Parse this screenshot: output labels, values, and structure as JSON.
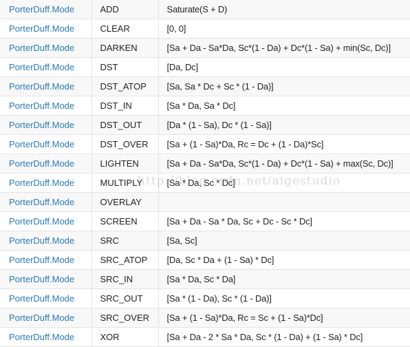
{
  "table": {
    "rows": [
      {
        "class": "PorterDuff.Mode",
        "mode": "ADD",
        "formula": "Saturate(S + D)"
      },
      {
        "class": "PorterDuff.Mode",
        "mode": "CLEAR",
        "formula": "[0, 0]"
      },
      {
        "class": "PorterDuff.Mode",
        "mode": "DARKEN",
        "formula": "[Sa + Da - Sa*Da, Sc*(1 - Da) + Dc*(1 - Sa) + min(Sc, Dc)]"
      },
      {
        "class": "PorterDuff.Mode",
        "mode": "DST",
        "formula": "[Da, Dc]"
      },
      {
        "class": "PorterDuff.Mode",
        "mode": "DST_ATOP",
        "formula": "[Sa, Sa * Dc + Sc * (1 - Da)]"
      },
      {
        "class": "PorterDuff.Mode",
        "mode": "DST_IN",
        "formula": "[Sa * Da, Sa * Dc]"
      },
      {
        "class": "PorterDuff.Mode",
        "mode": "DST_OUT",
        "formula": "[Da * (1 - Sa), Dc * (1 - Sa)]"
      },
      {
        "class": "PorterDuff.Mode",
        "mode": "DST_OVER",
        "formula": "[Sa + (1 - Sa)*Da, Rc = Dc + (1 - Da)*Sc]"
      },
      {
        "class": "PorterDuff.Mode",
        "mode": "LIGHTEN",
        "formula": "[Sa + Da - Sa*Da, Sc*(1 - Da) + Dc*(1 - Sa) + max(Sc, Dc)]"
      },
      {
        "class": "PorterDuff.Mode",
        "mode": "MULTIPLY",
        "formula": "[Sa * Da, Sc * Dc]"
      },
      {
        "class": "PorterDuff.Mode",
        "mode": "OVERLAY",
        "formula": ""
      },
      {
        "class": "PorterDuff.Mode",
        "mode": "SCREEN",
        "formula": "[Sa + Da - Sa * Da, Sc + Dc - Sc * Dc]"
      },
      {
        "class": "PorterDuff.Mode",
        "mode": "SRC",
        "formula": "[Sa, Sc]"
      },
      {
        "class": "PorterDuff.Mode",
        "mode": "SRC_ATOP",
        "formula": "[Da, Sc * Da + (1 - Sa) * Dc]"
      },
      {
        "class": "PorterDuff.Mode",
        "mode": "SRC_IN",
        "formula": "[Sa * Da, Sc * Da]"
      },
      {
        "class": "PorterDuff.Mode",
        "mode": "SRC_OUT",
        "formula": "[Sa * (1 - Da), Sc * (1 - Da)]"
      },
      {
        "class": "PorterDuff.Mode",
        "mode": "SRC_OVER",
        "formula": "[Sa + (1 - Sa)*Da, Rc = Sc + (1 - Sa)*Dc]"
      },
      {
        "class": "PorterDuff.Mode",
        "mode": "XOR",
        "formula": "[Sa + Da - 2 * Sa * Da, Sc * (1 - Da) + (1 - Sa) * Dc]"
      }
    ]
  },
  "watermark": "http://blog.csdn.net/aigestudio",
  "colors": {
    "class_link": "#2a7ab8",
    "text": "#222222",
    "row_alt": "#f8f8f8",
    "border": "#e4e4e4"
  }
}
